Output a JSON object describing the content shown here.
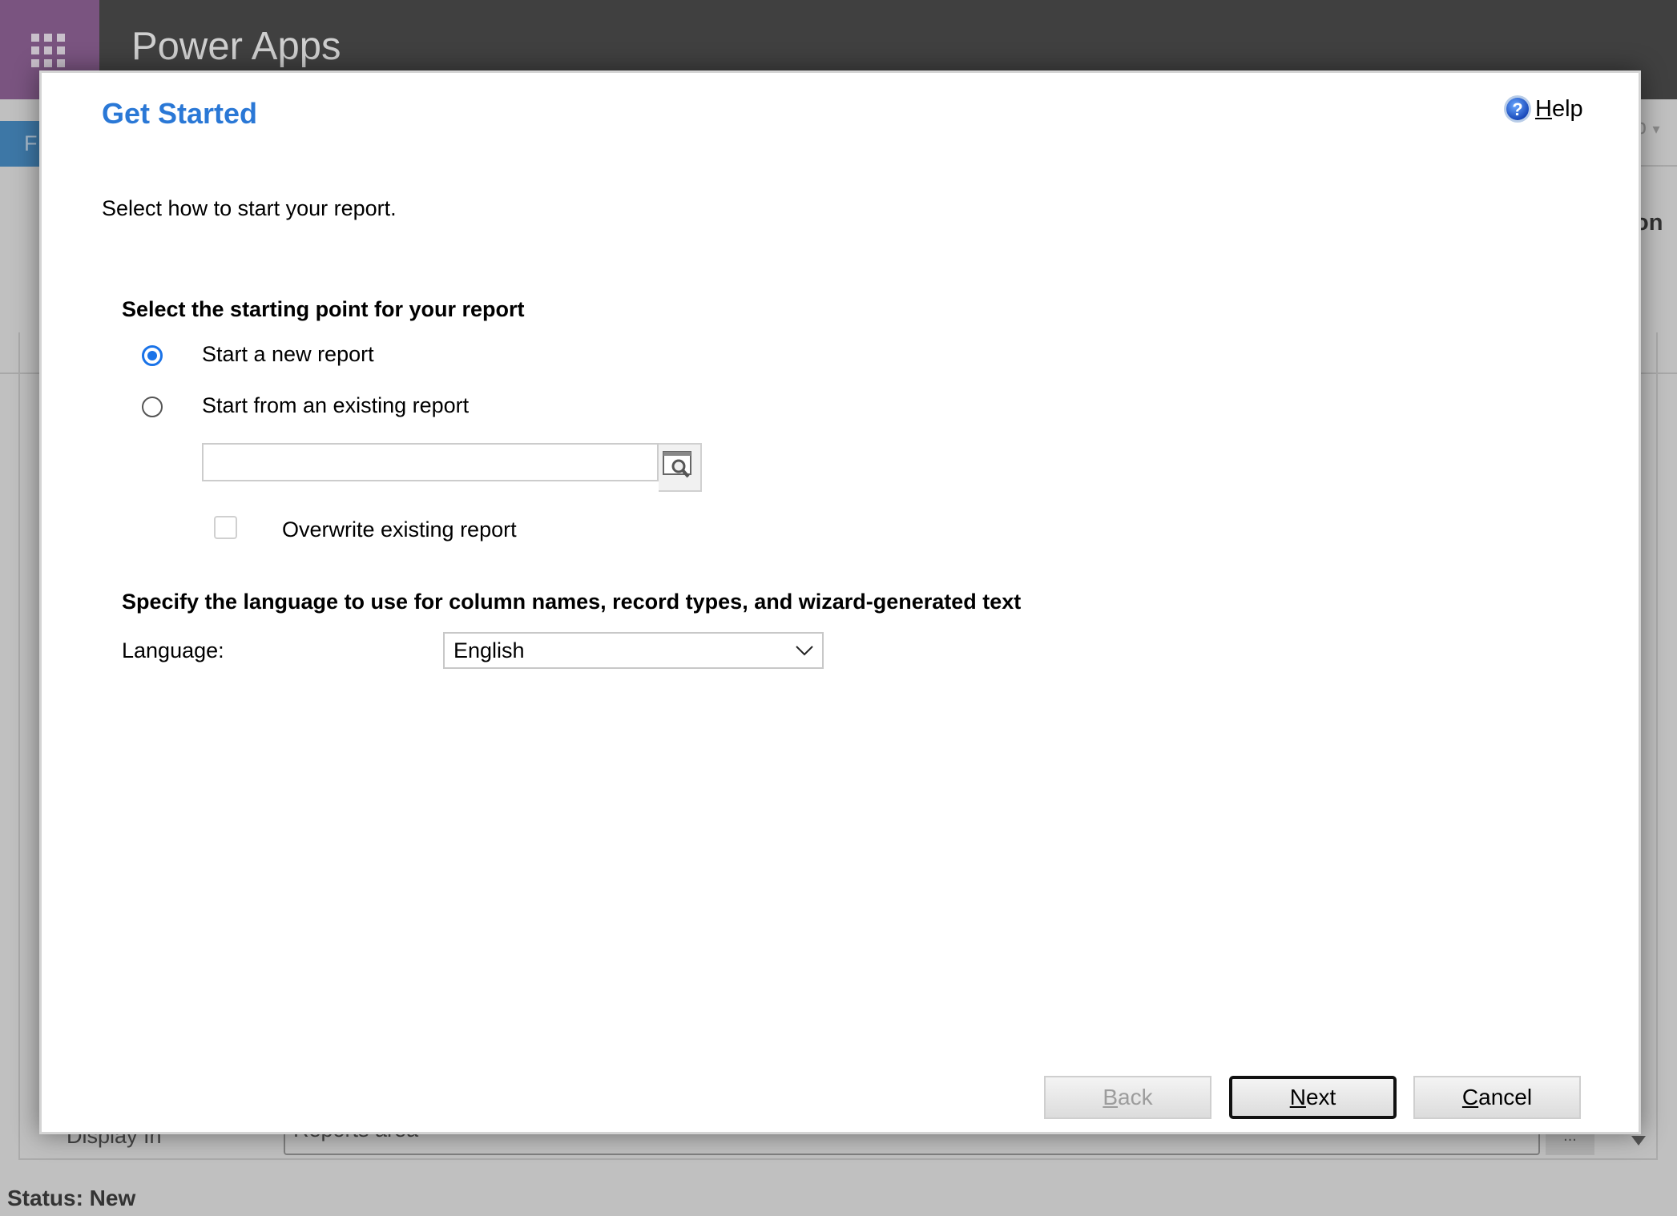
{
  "app": {
    "title": "Power Apps",
    "waffle_icon": "app-launcher-icon"
  },
  "background": {
    "tab_partial": "F",
    "right_menu_partial": "p",
    "right_heading_partial": "on",
    "display_in_label": "Display In",
    "display_in_value": "Reports area",
    "ellipsis": "...",
    "status": "Status: New"
  },
  "dialog": {
    "title": "Get Started",
    "help": {
      "access_key": "H",
      "rest": "elp",
      "icon": "help-question-icon"
    },
    "intro": "Select how to start your report.",
    "starting_point": {
      "heading": "Select the starting point for your report",
      "options": [
        {
          "label": "Start a new report",
          "selected": true
        },
        {
          "label": "Start from an existing report",
          "selected": false
        }
      ],
      "existing_report_value": "",
      "overwrite": {
        "label": "Overwrite existing report",
        "checked": false
      }
    },
    "language": {
      "heading": "Specify the language to use for column names, record types, and wizard-generated text",
      "label": "Language:",
      "selected": "English"
    },
    "buttons": {
      "back": {
        "key": "B",
        "rest": "ack",
        "enabled": false
      },
      "next": {
        "key": "N",
        "rest": "ext",
        "enabled": true
      },
      "cancel": {
        "key": "C",
        "rest": "ancel",
        "enabled": true
      }
    },
    "colors": {
      "title": "#2a78d6",
      "radio": "#1a73e8"
    }
  }
}
